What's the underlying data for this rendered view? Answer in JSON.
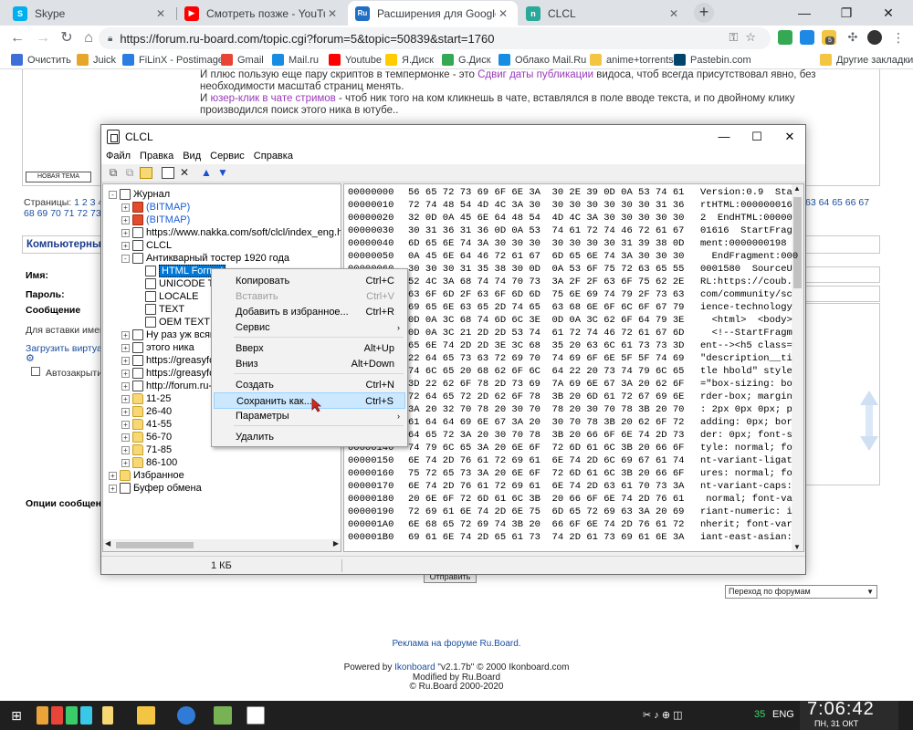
{
  "browser": {
    "tabs": [
      {
        "label": "Skype",
        "color": "#00aff0",
        "glyph": "S"
      },
      {
        "label": "Смотреть позже - YouTube",
        "color": "#ff0000",
        "glyph": "▶"
      },
      {
        "label": "Расширения для Google Chrome",
        "color": "#1f6fc5",
        "glyph": "Ru"
      },
      {
        "label": "CLCL",
        "color": "#2aa89a",
        "glyph": "n"
      }
    ],
    "url": "https://forum.ru-board.com/topic.cgi?forum=5&topic=50839&start=1760",
    "bookmarks": [
      {
        "label": "Очистить",
        "color": "#3d6fd8"
      },
      {
        "label": "Juick",
        "color": "#e6a62a"
      },
      {
        "label": "FiLinX - Postimage",
        "color": "#2a7de1"
      },
      {
        "label": "Gmail",
        "color": "#ea4335"
      },
      {
        "label": "Mail.ru",
        "color": "#168de2"
      },
      {
        "label": "Youtube",
        "color": "#ff0000"
      },
      {
        "label": "Я.Диск",
        "color": "#ffcc00"
      },
      {
        "label": "G.Диск",
        "color": "#34a853"
      },
      {
        "label": "Облако Mail.Ru",
        "color": "#168de2"
      },
      {
        "label": "anime+torrents",
        "color": "#f4c542"
      },
      {
        "label": "Pastebin.com",
        "color": "#02456c"
      },
      {
        "label": "Другие закладки",
        "color": "#f4c542"
      }
    ]
  },
  "forum": {
    "line1_pre": "И плюс пользую еще пару скриптов в темпермонке - это ",
    "line1_link": "Сдвиг даты публикации",
    "line1_post": " видоса, чтоб всегда присутствовал явно, без",
    "line2": "необходимости масштаб страниц менять.",
    "line3_pre": "И ",
    "line3_link": "юзер-клик в чате стримов",
    "line3_post": " - чтоб ник того на ком кликнешь в чате, вставлялся в поле вводе текста, и по двойному клику",
    "line4": "производился поиск этого ника в ютубе..",
    "new_topic": "НОВАЯ ТЕМА",
    "pages_label": "Страницы: ",
    "pages_left_1": "1 2 3 4",
    "pages_left_2": "68 69 70 71 72 73",
    "pages_right": "63 64 65 66 67",
    "section": "Компьютерны",
    "name_label": "Имя:",
    "pass_label": "Пароль:",
    "msg_label": "Сообщение",
    "insert_label": "Для вставки имен",
    "upload_link": "Загрузить виртуал",
    "autoclose": "Автозакрытие",
    "options_label": "Опции сообщени",
    "send_button": "Отправить",
    "jump_select": "Переход по форумам",
    "ad": "Реклама на форуме Ru.Board.",
    "powered_pre": "Powered by ",
    "powered_link": "Ikonboard",
    "powered_post": " \"v2.1.7b\" © 2000 Ikonboard.com",
    "modified": "Modified by Ru.Board",
    "copyright": "© Ru.Board 2000-2020"
  },
  "clcl": {
    "title": "CLCL",
    "menu": [
      "Файл",
      "Правка",
      "Вид",
      "Сервис",
      "Справка"
    ],
    "tree": [
      {
        "label": "Журнал",
        "icon": "doc",
        "pm": "-",
        "level": 0
      },
      {
        "label": "(BITMAP)",
        "icon": "bmp",
        "pm": "+",
        "level": 1,
        "blue": true
      },
      {
        "label": "(BITMAP)",
        "icon": "bmp",
        "pm": "+",
        "level": 1,
        "blue": true
      },
      {
        "label": "https://www.nakka.com/soft/clcl/index_eng.html",
        "icon": "doc",
        "pm": "+",
        "level": 1
      },
      {
        "label": "CLCL",
        "icon": "doc",
        "pm": "+",
        "level": 1
      },
      {
        "label": "Антикварный тостер 1920 года",
        "icon": "doc",
        "pm": "-",
        "level": 1
      },
      {
        "label": "HTML Format",
        "icon": "doc",
        "pm": "",
        "level": 2,
        "selected": true
      },
      {
        "label": "UNICODE TE",
        "icon": "doc",
        "pm": "",
        "level": 2
      },
      {
        "label": "LOCALE",
        "icon": "doc",
        "pm": "",
        "level": 2
      },
      {
        "label": "TEXT",
        "icon": "doc",
        "pm": "",
        "level": 2
      },
      {
        "label": "OEM TEXT",
        "icon": "doc",
        "pm": "",
        "level": 2
      },
      {
        "label": "Ну раз уж всяко",
        "icon": "doc",
        "pm": "+",
        "level": 1
      },
      {
        "label": "этого ника",
        "icon": "doc",
        "pm": "+",
        "level": 1
      },
      {
        "label": "https://greasyfork",
        "icon": "doc",
        "pm": "+",
        "level": 1
      },
      {
        "label": "https://greasyfork",
        "icon": "doc",
        "pm": "+",
        "level": 1
      },
      {
        "label": "http://forum.ru-bo",
        "icon": "doc",
        "pm": "+",
        "level": 1
      },
      {
        "label": "11-25",
        "icon": "folder",
        "pm": "+",
        "level": 1
      },
      {
        "label": "26-40",
        "icon": "folder",
        "pm": "+",
        "level": 1
      },
      {
        "label": "41-55",
        "icon": "folder",
        "pm": "+",
        "level": 1
      },
      {
        "label": "56-70",
        "icon": "folder",
        "pm": "+",
        "level": 1
      },
      {
        "label": "71-85",
        "icon": "folder",
        "pm": "+",
        "level": 1
      },
      {
        "label": "86-100",
        "icon": "folder",
        "pm": "+",
        "level": 1
      },
      {
        "label": "Избранное",
        "icon": "folder",
        "pm": "+",
        "level": 0
      },
      {
        "label": "Буфер обмена",
        "icon": "doc",
        "pm": "+",
        "level": 0
      }
    ],
    "hex": [
      {
        "addr": "00000000",
        "bytes": "56 65 72 73 69 6F 6E 3A  30 2E 39 0D 0A 53 74 61",
        "text": "Version:0.9  Sta"
      },
      {
        "addr": "00000010",
        "bytes": "72 74 48 54 4D 4C 3A 30  30 30 30 30 30 30 31 36",
        "text": "rtHTML:000000016"
      },
      {
        "addr": "00000020",
        "bytes": "32 0D 0A 45 6E 64 48 54  4D 4C 3A 30 30 30 30 30",
        "text": "2  EndHTML:00000"
      },
      {
        "addr": "00000030",
        "bytes": "30 31 36 31 36 0D 0A 53  74 61 72 74 46 72 61 67",
        "text": "01616  StartFrag"
      },
      {
        "addr": "00000040",
        "bytes": "6D 65 6E 74 3A 30 30 30  30 30 30 30 31 39 38 0D",
        "text": "ment:0000000198"
      },
      {
        "addr": "00000050",
        "bytes": "0A 45 6E 64 46 72 61 67  6D 65 6E 74 3A 30 30 30",
        "text": "  EndFragment:000"
      },
      {
        "addr": "00000060",
        "bytes": "30 30 30 31 35 38 30 0D  0A 53 6F 75 72 63 65 55",
        "text": "0001580  SourceU"
      },
      {
        "addr": "00000070",
        "bytes": "52 4C 3A 68 74 74 70 73  3A 2F 2F 63 6F 75 62 2E",
        "text": "RL:https://coub."
      },
      {
        "addr": "00000080",
        "bytes": "63 6F 6D 2F 63 6F 6D 6D  75 6E 69 74 79 2F 73 63",
        "text": "com/community/sc"
      },
      {
        "addr": "00000090",
        "bytes": "69 65 6E 63 65 2D 74 65  63 68 6E 6F 6C 6F 67 79",
        "text": "ience-technology"
      },
      {
        "addr": "000000A0",
        "bytes": "0D 0A 3C 68 74 6D 6C 3E  0D 0A 3C 62 6F 64 79 3E",
        "text": "  <html>  <body>"
      },
      {
        "addr": "000000B0",
        "bytes": "0D 0A 3C 21 2D 2D 53 74  61 72 74 46 72 61 67 6D",
        "text": "  <!--StartFragm"
      },
      {
        "addr": "000000C0",
        "bytes": "65 6E 74 2D 2D 3E 3C 68  35 20 63 6C 61 73 73 3D",
        "text": "ent--><h5 class="
      },
      {
        "addr": "000000D0",
        "bytes": "22 64 65 73 63 72 69 70  74 69 6F 6E 5F 5F 74 69",
        "text": "\"description__ti"
      },
      {
        "addr": "000000E0",
        "bytes": "74 6C 65 20 68 62 6F 6C  64 22 20 73 74 79 6C 65",
        "text": "tle hbold\" style"
      },
      {
        "addr": "000000F0",
        "bytes": "3D 22 62 6F 78 2D 73 69  7A 69 6E 67 3A 20 62 6F",
        "text": "=\"box-sizing: bo"
      },
      {
        "addr": "00000100",
        "bytes": "72 64 65 72 2D 62 6F 78  3B 20 6D 61 72 67 69 6E",
        "text": "rder-box; margin"
      },
      {
        "addr": "00000110",
        "bytes": "3A 20 32 70 78 20 30 70  78 20 30 70 78 3B 20 70",
        "text": ": 2px 0px 0px; p"
      },
      {
        "addr": "00000120",
        "bytes": "61 64 64 69 6E 67 3A 20  30 70 78 3B 20 62 6F 72",
        "text": "adding: 0px; bor"
      },
      {
        "addr": "00000130",
        "bytes": "64 65 72 3A 20 30 70 78  3B 20 66 6F 6E 74 2D 73",
        "text": "der: 0px; font-s"
      },
      {
        "addr": "00000140",
        "bytes": "74 79 6C 65 3A 20 6E 6F  72 6D 61 6C 3B 20 66 6F",
        "text": "tyle: normal; fo"
      },
      {
        "addr": "00000150",
        "bytes": "6E 74 2D 76 61 72 69 61  6E 74 2D 6C 69 67 61 74",
        "text": "nt-variant-ligat"
      },
      {
        "addr": "00000160",
        "bytes": "75 72 65 73 3A 20 6E 6F  72 6D 61 6C 3B 20 66 6F",
        "text": "ures: normal; fo"
      },
      {
        "addr": "00000170",
        "bytes": "6E 74 2D 76 61 72 69 61  6E 74 2D 63 61 70 73 3A",
        "text": "nt-variant-caps:"
      },
      {
        "addr": "00000180",
        "bytes": "20 6E 6F 72 6D 61 6C 3B  20 66 6F 6E 74 2D 76 61",
        "text": " normal; font-va"
      },
      {
        "addr": "00000190",
        "bytes": "72 69 61 6E 74 2D 6E 75  6D 65 72 69 63 3A 20 69",
        "text": "riant-numeric: i"
      },
      {
        "addr": "000001A0",
        "bytes": "6E 68 65 72 69 74 3B 20  66 6F 6E 74 2D 76 61 72",
        "text": "nherit; font-var"
      },
      {
        "addr": "000001B0",
        "bytes": "69 61 6E 74 2D 65 61 73  74 2D 61 73 69 61 6E 3A",
        "text": "iant-east-asian:"
      }
    ],
    "status_size": "1 КБ"
  },
  "context_menu": {
    "items": [
      {
        "label": "Копировать",
        "key": "Ctrl+C"
      },
      {
        "label": "Вставить",
        "key": "Ctrl+V",
        "disabled": true
      },
      {
        "label": "Добавить в избранное...",
        "key": "Ctrl+R"
      },
      {
        "label": "Сервис",
        "submenu": true
      },
      {
        "label": "Вверх",
        "key": "Alt+Up"
      },
      {
        "label": "Вниз",
        "key": "Alt+Down"
      },
      {
        "label": "Создать",
        "key": "Ctrl+N"
      },
      {
        "label": "Сохранить как...",
        "key": "Ctrl+S",
        "highlighted": true
      },
      {
        "label": "Параметры",
        "submenu": true
      },
      {
        "label": "Удалить",
        "key": ""
      }
    ]
  },
  "taskbar": {
    "tray_number": "35",
    "lang": "ENG",
    "time": "7:06:42",
    "date": "ПН, 31 ОКТ"
  },
  "ext_badge": "5"
}
